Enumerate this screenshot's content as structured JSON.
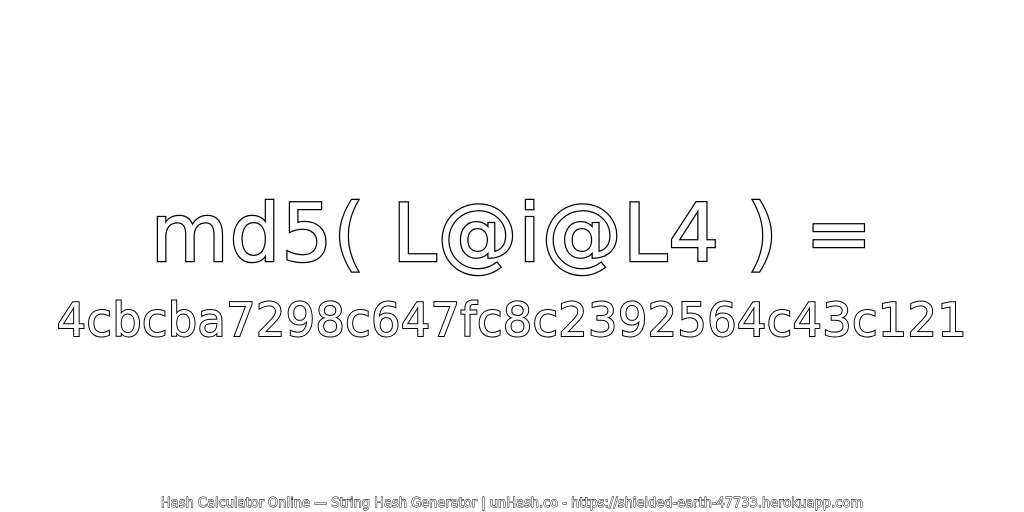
{
  "expression": "md5( L@i@L4 ) =",
  "hash_value": "4cbcba7298c647fc8c2392564c43c121",
  "footer": "Hash Calculator Online — String Hash Generator | unHash.co - https://shielded-earth-47733.herokuapp.com",
  "colors": {
    "background": "#ffffff",
    "text_fill": "#ffffff",
    "text_outline": "#000000"
  }
}
